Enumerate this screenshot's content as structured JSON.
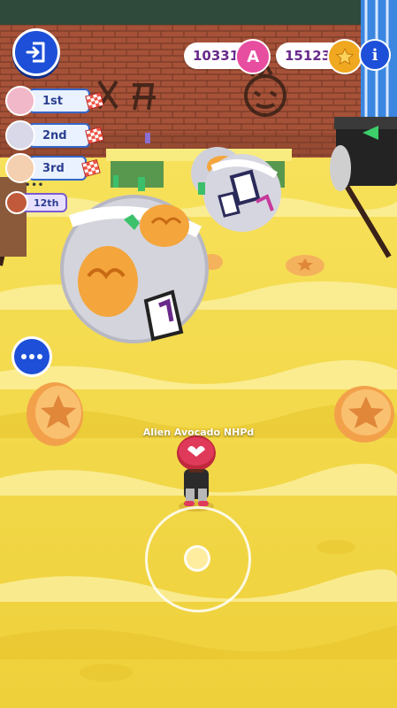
{
  "hud": {
    "exit_icon": "exit-door-icon",
    "currencies": [
      {
        "name": "tokens",
        "value": "10331",
        "icon": "a-token-icon",
        "icon_text": "A",
        "color": "#e84ea0"
      },
      {
        "name": "coins",
        "value": "15123",
        "icon": "star-coin-icon",
        "color": "#f0a820"
      }
    ],
    "info_label": "i",
    "menu_icon": "more-dots-icon"
  },
  "leaderboard": [
    {
      "rank": "1st"
    },
    {
      "rank": "2nd"
    },
    {
      "rank": "3rd"
    },
    {
      "rank": "12th"
    }
  ],
  "player": {
    "name": "Alien Avocado NHPd"
  },
  "colors": {
    "accent": "#1d4fd8",
    "floor": "#f3d53e",
    "wall": "#9a4a34"
  }
}
